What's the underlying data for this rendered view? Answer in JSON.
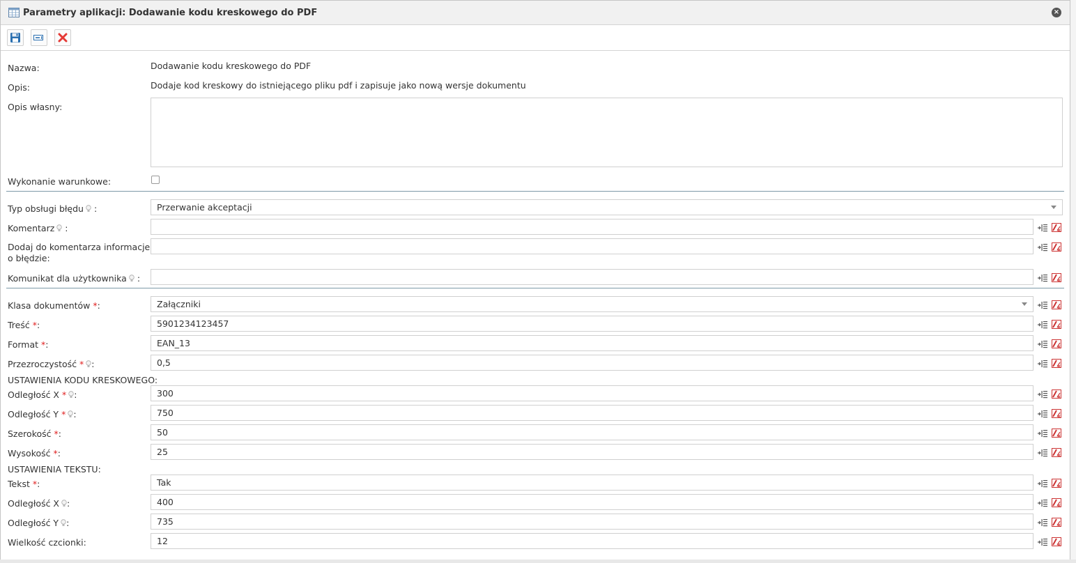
{
  "window": {
    "title": "Parametry aplikacji: Dodawanie kodu kreskowego do PDF",
    "close_label": "×"
  },
  "toolbar": {
    "buttons": [
      "save-icon",
      "variable-icon",
      "delete-icon"
    ]
  },
  "info": {
    "name_label": "Nazwa:",
    "name_value": "Dodawanie kodu kreskowego do PDF",
    "desc_label": "Opis:",
    "desc_value": "Dodaje kod kreskowy do istniejącego pliku pdf i zapisuje jako nową wersje dokumentu",
    "own_desc_label": "Opis własny:",
    "own_desc_value": "",
    "conditional_label": "Wykonanie warunkowe:",
    "conditional_checked": false
  },
  "errors": {
    "type_label": "Typ obsługi błędu",
    "type_value": "Przerwanie akceptacji",
    "comment_label": "Komentarz",
    "comment_value": "",
    "add_info_label": "Dodaj do komentarza informacje o błędzie:",
    "add_info_value": "",
    "user_msg_label": "Komunikat dla użytkownika",
    "user_msg_value": ""
  },
  "params": {
    "doc_class_label": "Klasa dokumentów",
    "doc_class_value": "Załączniki",
    "content_label": "Treść",
    "content_value": "5901234123457",
    "format_label": "Format",
    "format_value": "EAN_13",
    "opacity_label": "Przezroczystość",
    "opacity_value": "0,5",
    "barcode_section": "USTAWIENIA KODU KRESKOWEGO:",
    "dist_x_label": "Odległość X",
    "dist_x_value": "300",
    "dist_y_label": "Odległość Y",
    "dist_y_value": "750",
    "width_label": "Szerokość",
    "width_value": "50",
    "height_label": "Wysokość",
    "height_value": "25",
    "text_section": "USTAWIENIA TEKSTU:",
    "text_label": "Tekst",
    "text_value": "Tak",
    "text_x_label": "Odległość X",
    "text_x_value": "400",
    "text_y_label": "Odległość Y",
    "text_y_value": "735",
    "font_size_label": "Wielkość czcionki:",
    "font_size_value": "12"
  },
  "symbols": {
    "required": "*",
    "colon": ":"
  },
  "colors": {
    "required": "#e02020",
    "divider": "#7d99a8",
    "delete": "#e53935",
    "save": "#2a6fb0"
  }
}
